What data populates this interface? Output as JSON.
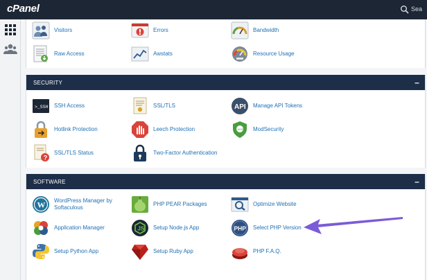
{
  "header": {
    "logo_text": "cPanel",
    "search_placeholder": "Sea"
  },
  "sidebar": {
    "items": [
      {
        "icon": "grid-icon"
      },
      {
        "icon": "users-icon"
      }
    ]
  },
  "metrics": {
    "items": [
      {
        "label": "Visitors",
        "icon": "visitors-icon"
      },
      {
        "label": "Errors",
        "icon": "errors-icon"
      },
      {
        "label": "Bandwidth",
        "icon": "bandwidth-icon"
      },
      {
        "label": "Raw Access",
        "icon": "raw-access-icon"
      },
      {
        "label": "Awstats",
        "icon": "awstats-icon"
      },
      {
        "label": "Resource Usage",
        "icon": "resource-usage-icon"
      }
    ]
  },
  "security": {
    "title": "SECURITY",
    "collapse_label": "–",
    "items": [
      {
        "label": "SSH Access",
        "icon": "ssh-icon"
      },
      {
        "label": "SSL/TLS",
        "icon": "ssl-certificate-icon"
      },
      {
        "label": "Manage API Tokens",
        "icon": "api-icon"
      },
      {
        "label": "Hotlink Protection",
        "icon": "hotlink-lock-icon"
      },
      {
        "label": "Leech Protection",
        "icon": "leech-hand-icon"
      },
      {
        "label": "ModSecurity",
        "icon": "modsecurity-shield-icon"
      },
      {
        "label": "SSL/TLS Status",
        "icon": "ssl-status-icon"
      },
      {
        "label": "Two-Factor Authentication",
        "icon": "two-factor-lock-icon"
      }
    ]
  },
  "software": {
    "title": "SOFTWARE",
    "collapse_label": "–",
    "items": [
      {
        "label": "WordPress Manager by Softaculous",
        "icon": "wordpress-icon"
      },
      {
        "label": "PHP PEAR Packages",
        "icon": "pear-icon"
      },
      {
        "label": "Optimize Website",
        "icon": "optimize-icon"
      },
      {
        "label": "Application Manager",
        "icon": "application-manager-icon"
      },
      {
        "label": "Setup Node.js App",
        "icon": "nodejs-icon"
      },
      {
        "label": "Select PHP Version",
        "icon": "php-icon"
      },
      {
        "label": "Setup Python App",
        "icon": "python-icon"
      },
      {
        "label": "Setup Ruby App",
        "icon": "ruby-icon"
      },
      {
        "label": "PHP F.A.Q.",
        "icon": "php-faq-icon"
      }
    ]
  },
  "annotation": {
    "arrow_color": "#7b5cd6"
  }
}
